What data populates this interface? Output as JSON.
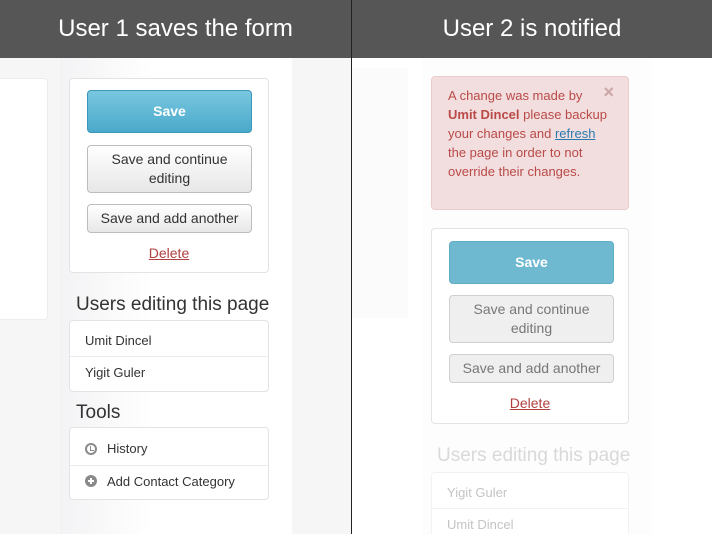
{
  "left": {
    "header": "User 1 saves the form",
    "actions": {
      "save_label": "Save",
      "save_continue_label": "Save and continue editing",
      "save_add_label": "Save and add another",
      "delete_label": "Delete"
    },
    "users_editing": {
      "title": "Users editing this page",
      "items": [
        "Umit Dincel",
        "Yigit Guler"
      ]
    },
    "tools": {
      "title": "Tools",
      "items": [
        {
          "label": "History",
          "icon": "clock-icon"
        },
        {
          "label": "Add Contact Category",
          "icon": "plus-circle-icon"
        }
      ]
    }
  },
  "right": {
    "header": "User 2 is notified",
    "alert": {
      "prefix": "A change was made by ",
      "user": "Umit Dincel",
      "middle": " please backup your changes and ",
      "link": "refresh",
      "suffix": " the page in order to not override their changes.",
      "close": "×"
    },
    "actions": {
      "save_label": "Save",
      "save_continue_label": "Save and continue editing",
      "save_add_label": "Save and add another",
      "delete_label": "Delete"
    },
    "users_editing": {
      "title": "Users editing this page",
      "items": [
        "Yigit Guler",
        "Umit Dincel"
      ]
    }
  },
  "colors": {
    "header_bg": "#565656",
    "primary_button": "#4aa9cb",
    "alert_bg": "#f2dede",
    "alert_text": "#b94a48",
    "delete_link": "#b0413e"
  }
}
